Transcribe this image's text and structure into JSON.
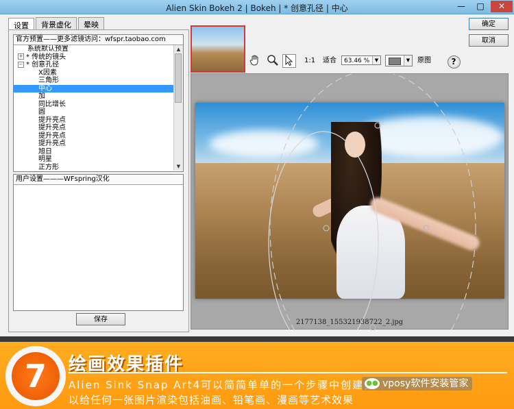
{
  "window": {
    "title": "Alien Skin Bokeh 2 | Bokeh | * 创意孔径 | 中心",
    "minimize_glyph": "—",
    "maximize_glyph": "□",
    "close_glyph": "✕"
  },
  "tabs": [
    {
      "label": "设置"
    },
    {
      "label": "背景虚化"
    },
    {
      "label": "晕映"
    }
  ],
  "presets": {
    "header": "官方预置——更多滤镜访问：wfspr.taobao.com",
    "items": [
      {
        "label": "系统默认预置",
        "expander": ""
      },
      {
        "label": "* 传统的镜头",
        "expander": "+"
      },
      {
        "label": "* 创意孔径",
        "expander": "−"
      },
      {
        "label": "X因素",
        "expander": ""
      },
      {
        "label": "三角形",
        "expander": ""
      },
      {
        "label": "中心",
        "expander": "",
        "selected": true
      },
      {
        "label": "加",
        "expander": ""
      },
      {
        "label": "同比增长",
        "expander": ""
      },
      {
        "label": "圆",
        "expander": ""
      },
      {
        "label": "提升亮点",
        "expander": ""
      },
      {
        "label": "提升亮点",
        "expander": ""
      },
      {
        "label": "提升亮点",
        "expander": ""
      },
      {
        "label": "提升亮点",
        "expander": ""
      },
      {
        "label": "旭日",
        "expander": ""
      },
      {
        "label": "明星",
        "expander": ""
      },
      {
        "label": "正方形",
        "expander": ""
      }
    ],
    "scroll_up": "▲",
    "scroll_down": "▼"
  },
  "user_settings": {
    "header": "用户设置———WFspring汉化"
  },
  "save_label": "保存",
  "ok_label": "确定",
  "cancel_label": "取消",
  "toolbar": {
    "hand_icon": "hand-icon",
    "zoom_icon": "magnifier-icon",
    "select_icon": "arrow-pointer-icon",
    "one_to_one": "1:1",
    "fit": "适合",
    "zoom_value": "63.46 %",
    "bg_color": "#808080",
    "original": "原图",
    "help": "?"
  },
  "canvas": {
    "filename": "2177138_155321938722_2.jpg"
  },
  "banner": {
    "number": "7",
    "title": "绘画效果插件",
    "line1": "Alien Sink Snap Art4可以简简单单的一个步骤中创建美",
    "line2": "以给任何一张图片渲染包括油画、铅笔画、漫画等艺术效果",
    "watermark": "vposy软件安装管家",
    "accent": "#ff9a10"
  }
}
